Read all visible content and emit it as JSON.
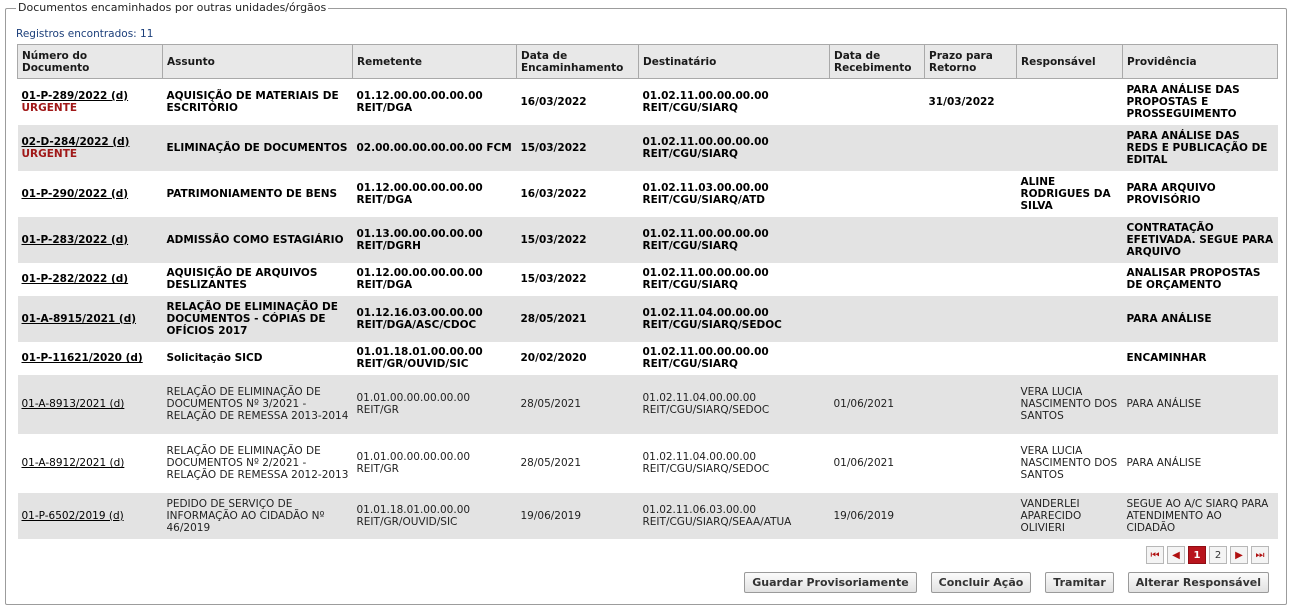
{
  "panel": {
    "legend": "Documentos encaminhados por outras unidades/órgãos",
    "records_label": "Registros encontrados: 11"
  },
  "columns": [
    "Número do Documento",
    "Assunto",
    "Remetente",
    "Data de Encaminhamento",
    "Destinatário",
    "Data de Recebimento",
    "Prazo para Retorno",
    "Responsável",
    "Providência"
  ],
  "rows": [
    {
      "doc": "01-P-289/2022 (d)",
      "urgent": "URGENTE",
      "assunto": "AQUISIÇÃO DE MATERIAIS DE ESCRITÓRIO",
      "remetente": "01.12.00.00.00.00.00 REIT/DGA",
      "data_enc": "16/03/2022",
      "destinatario": "01.02.11.00.00.00.00 REIT/CGU/SIARQ",
      "data_rec": "",
      "prazo": "31/03/2022",
      "responsavel": "",
      "providencia": "PARA ANÁLISE DAS PROPOSTAS E PROSSEGUIMENTO",
      "bold": true
    },
    {
      "doc": "02-D-284/2022 (d)",
      "urgent": "URGENTE",
      "assunto": "ELIMINAÇÃO DE DOCUMENTOS",
      "remetente": "02.00.00.00.00.00.00 FCM",
      "data_enc": "15/03/2022",
      "destinatario": "01.02.11.00.00.00.00 REIT/CGU/SIARQ",
      "data_rec": "",
      "prazo": "",
      "responsavel": "",
      "providencia": "PARA ANÁLISE DAS REDS E PUBLICAÇÃO DE EDITAL",
      "bold": true
    },
    {
      "doc": "01-P-290/2022 (d)",
      "urgent": "",
      "assunto": "PATRIMONIAMENTO DE BENS",
      "remetente": "01.12.00.00.00.00.00 REIT/DGA",
      "data_enc": "16/03/2022",
      "destinatario": "01.02.11.03.00.00.00 REIT/CGU/SIARQ/ATD",
      "data_rec": "",
      "prazo": "",
      "responsavel": "ALINE RODRIGUES DA SILVA",
      "providencia": "PARA ARQUIVO PROVISÓRIO",
      "bold": true
    },
    {
      "doc": "01-P-283/2022 (d)",
      "urgent": "",
      "assunto": "ADMISSÃO COMO ESTAGIÁRIO",
      "remetente": "01.13.00.00.00.00.00 REIT/DGRH",
      "data_enc": "15/03/2022",
      "destinatario": "01.02.11.00.00.00.00 REIT/CGU/SIARQ",
      "data_rec": "",
      "prazo": "",
      "responsavel": "",
      "providencia": "CONTRATAÇÃO EFETIVADA. SEGUE PARA ARQUIVO",
      "bold": true
    },
    {
      "doc": "01-P-282/2022 (d)",
      "urgent": "",
      "assunto": "AQUISIÇÃO DE ARQUIVOS DESLIZANTES",
      "remetente": "01.12.00.00.00.00.00 REIT/DGA",
      "data_enc": "15/03/2022",
      "destinatario": "01.02.11.00.00.00.00 REIT/CGU/SIARQ",
      "data_rec": "",
      "prazo": "",
      "responsavel": "",
      "providencia": "ANALISAR PROPOSTAS DE ORÇAMENTO",
      "bold": true
    },
    {
      "doc": "01-A-8915/2021 (d)",
      "urgent": "",
      "assunto": "RELAÇÃO DE ELIMINAÇÃO DE DOCUMENTOS - CÓPIAS DE OFÍCIOS 2017",
      "remetente": "01.12.16.03.00.00.00 REIT/DGA/ASC/CDOC",
      "data_enc": "28/05/2021",
      "destinatario": "01.02.11.04.00.00.00 REIT/CGU/SIARQ/SEDOC",
      "data_rec": "",
      "prazo": "",
      "responsavel": "",
      "providencia": "PARA ANÁLISE",
      "bold": true
    },
    {
      "doc": "01-P-11621/2020 (d)",
      "urgent": "",
      "assunto": "Solicitação SICD",
      "remetente": "01.01.18.01.00.00.00 REIT/GR/OUVID/SIC",
      "data_enc": "20/02/2020",
      "destinatario": "01.02.11.00.00.00.00 REIT/CGU/SIARQ",
      "data_rec": "",
      "prazo": "",
      "responsavel": "",
      "providencia": "ENCAMINHAR",
      "bold": true
    },
    {
      "doc": "01-A-8913/2021 (d)",
      "urgent": "",
      "assunto": "RELAÇÃO DE ELIMINAÇÃO DE DOCUMENTOS Nº 3/2021 - RELAÇÃO DE REMESSA 2013-2014",
      "remetente": "01.01.00.00.00.00.00 REIT/GR",
      "data_enc": "28/05/2021",
      "destinatario": "01.02.11.04.00.00.00 REIT/CGU/SIARQ/SEDOC",
      "data_rec": "01/06/2021",
      "prazo": "",
      "responsavel": "VERA LUCIA NASCIMENTO DOS SANTOS",
      "providencia": "PARA ANÁLISE",
      "bold": false
    },
    {
      "doc": "01-A-8912/2021 (d)",
      "urgent": "",
      "assunto": "RELAÇÃO DE ELIMINAÇÃO DE DOCUMENTOS Nº 2/2021 - RELAÇÃO DE REMESSA 2012-2013",
      "remetente": "01.01.00.00.00.00.00 REIT/GR",
      "data_enc": "28/05/2021",
      "destinatario": "01.02.11.04.00.00.00 REIT/CGU/SIARQ/SEDOC",
      "data_rec": "01/06/2021",
      "prazo": "",
      "responsavel": "VERA LUCIA NASCIMENTO DOS SANTOS",
      "providencia": "PARA ANÁLISE",
      "bold": false
    },
    {
      "doc": "01-P-6502/2019 (d)",
      "urgent": "",
      "assunto": "PEDIDO DE SERVIÇO DE INFORMAÇÃO AO CIDADÃO Nº 46/2019",
      "remetente": "01.01.18.01.00.00.00 REIT/GR/OUVID/SIC",
      "data_enc": "19/06/2019",
      "destinatario": "01.02.11.06.03.00.00 REIT/CGU/SIARQ/SEAA/ATUA",
      "data_rec": "19/06/2019",
      "prazo": "",
      "responsavel": "VANDERLEI APARECIDO OLIVIERI",
      "providencia": "SEGUE AO A/C SIARQ PARA ATENDIMENTO AO CIDADÃO",
      "bold": false
    }
  ],
  "pager": {
    "first_icon": "⏮",
    "prev_icon": "◀",
    "pages": [
      "1",
      "2"
    ],
    "next_icon": "▶",
    "last_icon": "⏭",
    "current": "1"
  },
  "buttons": {
    "guardar": "Guardar Provisoriamente",
    "concluir": "Concluir Ação",
    "tramitar": "Tramitar",
    "alterar": "Alterar Responsável"
  },
  "colors": {
    "urgent": "#a01818",
    "header_bg": "#e8e8e8",
    "row_alt_bg": "#e3e3e3",
    "active_page": "#b8141d",
    "records_text": "#1c3f7a"
  }
}
